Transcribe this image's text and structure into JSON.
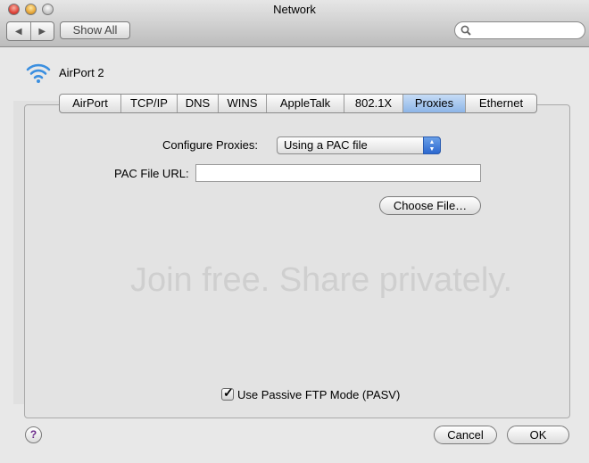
{
  "window": {
    "title": "Network"
  },
  "toolbar": {
    "back_label": "◀",
    "forward_label": "▶",
    "show_all_label": "Show All",
    "search_placeholder": ""
  },
  "interface": {
    "name": "AirPort 2",
    "icon": "wifi-icon"
  },
  "tabs": [
    {
      "label": "AirPort",
      "active": false
    },
    {
      "label": "TCP/IP",
      "active": false
    },
    {
      "label": "DNS",
      "active": false
    },
    {
      "label": "WINS",
      "active": false
    },
    {
      "label": "AppleTalk",
      "active": false
    },
    {
      "label": "802.1X",
      "active": false
    },
    {
      "label": "Proxies",
      "active": true
    },
    {
      "label": "Ethernet",
      "active": false
    }
  ],
  "proxies": {
    "configure_label": "Configure Proxies:",
    "configure_value": "Using a PAC file",
    "pac_url_label": "PAC File URL:",
    "pac_url_value": "",
    "choose_file_label": "Choose File…",
    "passive_ftp_label": "Use Passive FTP Mode (PASV)",
    "passive_ftp_checked": true
  },
  "footer": {
    "help_label": "?",
    "cancel_label": "Cancel",
    "ok_label": "OK"
  },
  "watermark": {
    "text": "Join free. Share privately."
  },
  "colors": {
    "active_tab": "#8db5e7",
    "select_arrow": "#2c68cf"
  }
}
